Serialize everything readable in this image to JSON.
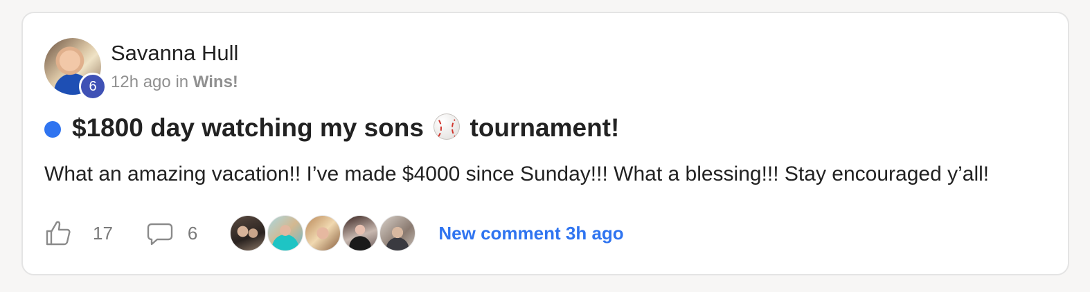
{
  "post": {
    "author": {
      "name": "Savanna Hull",
      "level": "6"
    },
    "meta": {
      "time": "12h ago",
      "in_word": "in",
      "category": "Wins!"
    },
    "title": {
      "before": "$1800 day watching my sons",
      "emoji": "baseball-emoji",
      "after": "tournament!"
    },
    "body": "What an amazing vacation!! I’ve made $4000 since Sunday!!! What a blessing!!! Stay encouraged y’all!",
    "likes": "17",
    "comments": "6",
    "commenters": [
      "commenter-avatar-1",
      "commenter-avatar-2",
      "commenter-avatar-3",
      "commenter-avatar-4",
      "commenter-avatar-5"
    ],
    "new_comment_label": "New comment 3h ago"
  },
  "colors": {
    "accent": "#2f74f0",
    "level_badge": "#3f51b5",
    "text": "#222222",
    "muted": "#909090"
  },
  "icons": {
    "like": "thumbs-up-icon",
    "comment": "speech-bubble-icon",
    "unread": "unread-dot"
  }
}
